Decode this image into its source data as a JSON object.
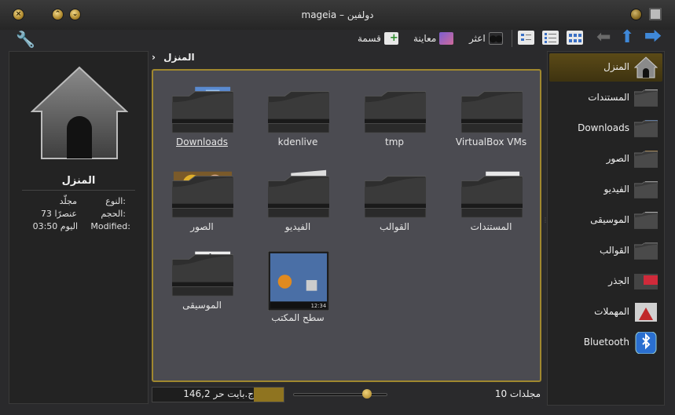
{
  "window": {
    "title": "mageia – دولفين"
  },
  "toolbar": {
    "split_label": "قسمة",
    "preview_label": "معاينة",
    "find_label": "اعثر"
  },
  "breadcrumb": {
    "current": "المنزل"
  },
  "info": {
    "title": "المنزل",
    "rows": [
      {
        "key": "النوع:",
        "value": "مجلّد"
      },
      {
        "key": "الحجم:",
        "value": "73 عنصرًا"
      },
      {
        "key": "Modified:",
        "value": "اليوم 03:50"
      }
    ]
  },
  "items": [
    {
      "name": "VirtualBox VMs",
      "icon": "folder-icon"
    },
    {
      "name": "tmp",
      "icon": "folder-icon"
    },
    {
      "name": "kdenlive",
      "icon": "folder-icon"
    },
    {
      "name": "Downloads",
      "icon": "folder-downloads-icon"
    },
    {
      "name": "المستندات",
      "icon": "folder-documents-icon"
    },
    {
      "name": "القوالب",
      "icon": "folder-templates-icon"
    },
    {
      "name": "الفيديو",
      "icon": "folder-video-icon"
    },
    {
      "name": "الصور",
      "icon": "folder-pictures-icon"
    },
    {
      "name": "سطح المكتب",
      "icon": "desktop-icon"
    },
    {
      "name": "الموسيقى",
      "icon": "folder-music-icon"
    }
  ],
  "status": {
    "folder_count": "10 مجلدات",
    "free_space": "146,2 ج.بايت حر"
  },
  "places": [
    {
      "label": "المنزل",
      "icon": "home-icon",
      "selected": true
    },
    {
      "label": "المستندات",
      "icon": "folder-documents-icon"
    },
    {
      "label": "Downloads",
      "icon": "folder-downloads-icon"
    },
    {
      "label": "الصور",
      "icon": "folder-pictures-icon"
    },
    {
      "label": "الفيديو",
      "icon": "folder-video-icon"
    },
    {
      "label": "الموسيقى",
      "icon": "folder-music-icon"
    },
    {
      "label": "القوالب",
      "icon": "folder-templates-icon"
    },
    {
      "label": "الجذر",
      "icon": "folder-root-icon"
    },
    {
      "label": "المهملات",
      "icon": "trash-icon"
    },
    {
      "label": "Bluetooth",
      "icon": "bluetooth-icon"
    }
  ],
  "colors": {
    "accent": "#a0882f",
    "view_bg": "#4b4b51"
  }
}
